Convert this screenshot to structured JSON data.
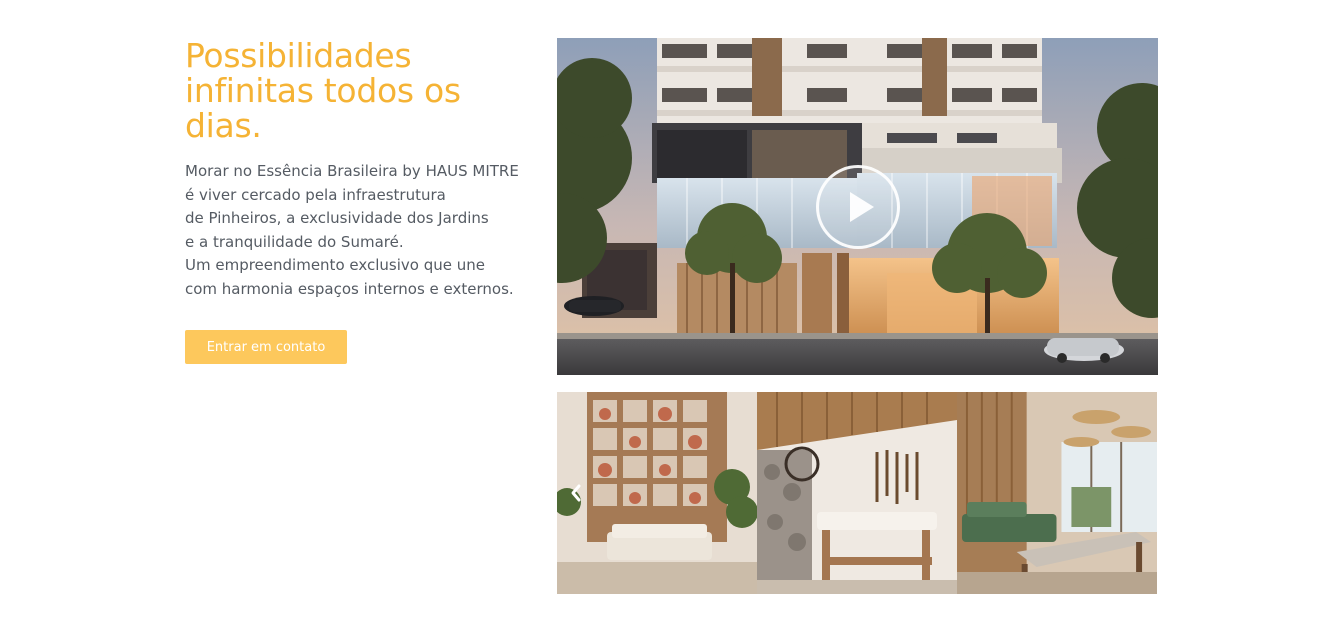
{
  "section": {
    "headline": [
      "Possibilidades",
      "infinitas todos os",
      "dias."
    ],
    "intro_lines": [
      "Morar no Essência Brasileira by HAUS MITRE",
      "é viver cercado pela infraestrutura",
      "de Pinheiros, a exclusividade dos Jardins",
      "e a tranquilidade do Sumaré.",
      "Um empreendimento exclusivo que une",
      "com harmonia espaços internos e externos."
    ],
    "cta_label": "Entrar em contato"
  },
  "hero_video": {
    "icon": "play-icon"
  },
  "gallery": {
    "prev_icon": "chevron-left-icon",
    "slides": [
      {
        "name": "living-room"
      },
      {
        "name": "spa-room"
      },
      {
        "name": "game-room"
      }
    ]
  },
  "colors": {
    "accent": "#f5b335",
    "button": "#fdc85c",
    "body_text": "#555b63",
    "background": "#ffffff"
  }
}
